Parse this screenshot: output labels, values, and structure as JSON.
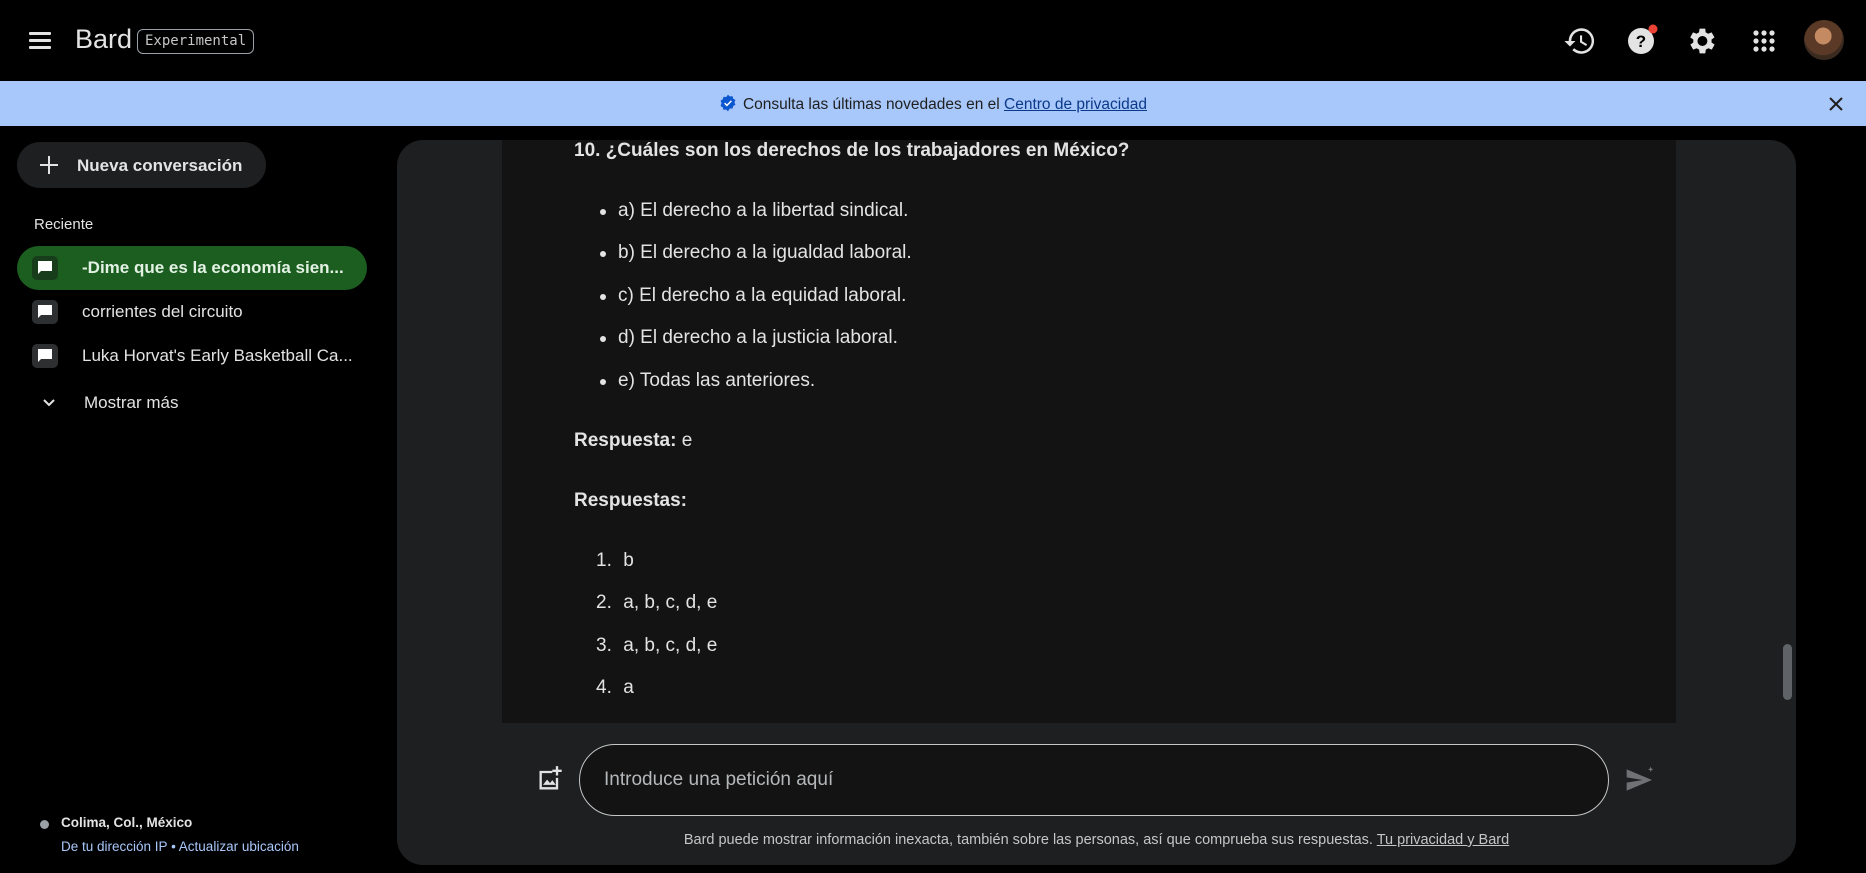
{
  "header": {
    "brand": "Bard",
    "badge": "Experimental",
    "icons": [
      "history-icon",
      "help-icon",
      "settings-icon",
      "apps-grid-icon",
      "avatar"
    ],
    "notification_color": "#ea4335"
  },
  "banner": {
    "text": "Consulta las últimas novedades en el ",
    "link": "Centro de privacidad",
    "bg_color": "#a8c7fa"
  },
  "sidebar": {
    "new_chat": "Nueva conversación",
    "recent_heading": "Reciente",
    "conversations": [
      {
        "title": "-Dime que es la economía sien...",
        "active": true
      },
      {
        "title": "corrientes del circuito",
        "active": false
      },
      {
        "title": "Luka Horvat's Early Basketball Ca...",
        "active": false
      }
    ],
    "show_more": "Mostrar más",
    "location": {
      "name": "Colima, Col., México",
      "ip_link": "De tu dirección IP",
      "separator": " • ",
      "update_link": "Actualizar ubicación"
    },
    "active_color": "#1b5e20"
  },
  "response": {
    "question": "10. ¿Cuáles son los derechos de los trabajadores en México?",
    "options": [
      "a) El derecho a la libertad sindical.",
      "b) El derecho a la igualdad laboral.",
      "c) El derecho a la equidad laboral.",
      "d) El derecho a la justicia laboral.",
      "e) Todas las anteriores."
    ],
    "answer_label": "Respuesta:",
    "answer_value": " e",
    "answers_heading": "Respuestas:",
    "answers_list": [
      {
        "n": "1.",
        "v": "b"
      },
      {
        "n": "2.",
        "v": "a, b, c, d, e"
      },
      {
        "n": "3.",
        "v": "a, b, c, d, e"
      },
      {
        "n": "4.",
        "v": "a"
      }
    ]
  },
  "input": {
    "placeholder": "Introduce una petición aquí"
  },
  "footer": {
    "disclaimer": "Bard puede mostrar información inexacta, también sobre las personas, así que comprueba sus respuestas. ",
    "link": "Tu privacidad y Bard"
  }
}
